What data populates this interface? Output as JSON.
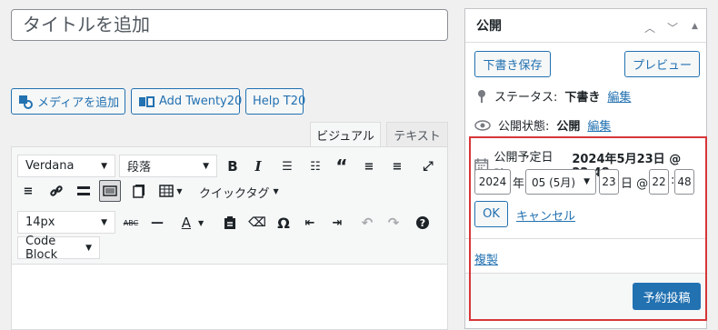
{
  "title_placeholder": "タイトルを追加",
  "media_buttons": {
    "add_media": "メディアを追加",
    "add_twenty": "Add Twenty20",
    "help": "Help T20"
  },
  "tabs": {
    "visual": "ビジュアル",
    "text": "テキスト"
  },
  "toolbar": {
    "font_family": "Verdana",
    "format": "段落",
    "quick_tags": "クイックタグ",
    "font_size": "14px",
    "code_block": "Code Block"
  },
  "publish": {
    "heading": "公開",
    "save_draft": "下書き保存",
    "preview": "プレビュー",
    "status_label": "ステータス:",
    "status_value": "下書き",
    "edit": "編集",
    "visibility_label": "公開状態:",
    "visibility_value": "公開",
    "schedule_label": "公開予定日時:",
    "schedule_value": "2024年5月23日 @ 22:48",
    "year": "2024",
    "year_unit": "年",
    "month": "05 (5月)",
    "day": "23",
    "day_unit": "日 @",
    "hour": "22",
    "minute": "48",
    "ok": "OK",
    "cancel": "キャンセル",
    "duplicate": "複製",
    "schedule_button": "予約投稿"
  },
  "colors": {
    "accent": "#2271b1",
    "highlight_border": "#d63638"
  }
}
